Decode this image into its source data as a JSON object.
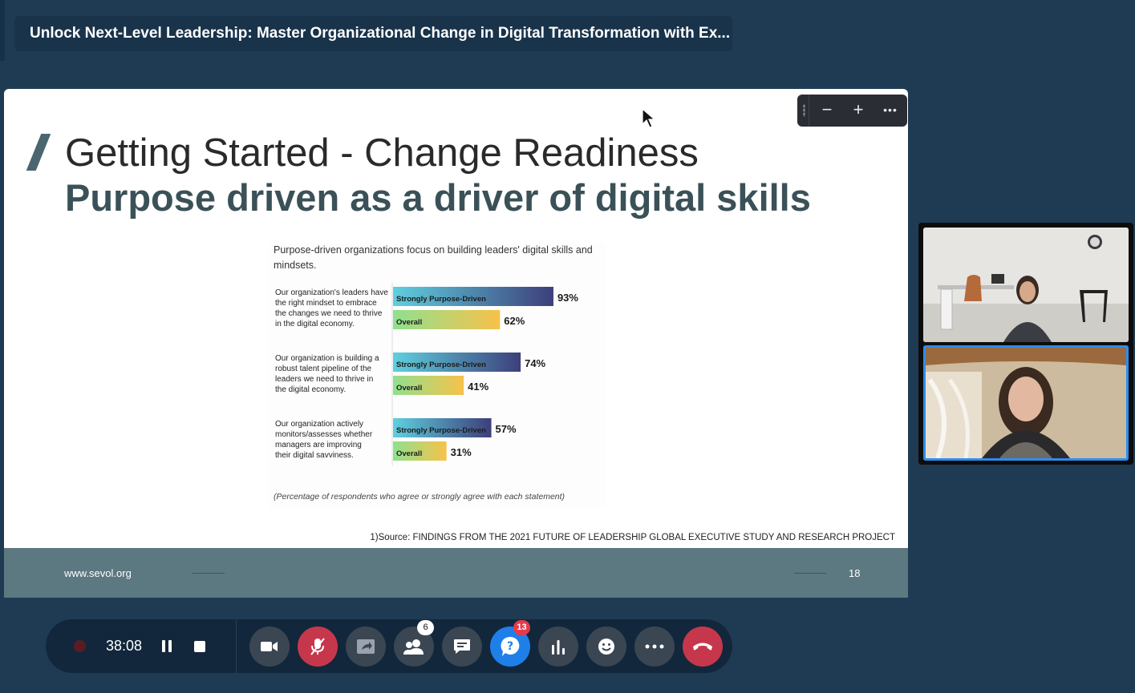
{
  "window": {
    "title": "Unlock Next-Level Leadership: Master Organizational Change in Digital Transformation with Ex..."
  },
  "slide": {
    "title": "Getting Started - Change Readiness",
    "subtitle": "Purpose driven as a driver of digital skills",
    "source": "1)Source: FINDINGS FROM THE 2021 FUTURE OF LEADERSHIP GLOBAL EXECUTIVE STUDY AND RESEARCH PROJECT",
    "footer_url": "www.sevol.org",
    "page_number": "18"
  },
  "chart_data": {
    "type": "bar",
    "title": "Purpose-driven organizations focus on building leaders' digital skills and mindsets.",
    "categories": [
      [
        "Our organization's leaders have",
        "the right mindset to embrace",
        "the changes we need to thrive",
        "in the digital economy."
      ],
      [
        "Our organization is building a",
        "robust talent pipeline of the",
        "leaders we need to thrive in",
        "the digital economy."
      ],
      [
        "Our organization actively",
        "monitors/assesses whether",
        "managers are improving",
        "their digital savviness."
      ]
    ],
    "series": [
      {
        "name": "Strongly Purpose-Driven",
        "values": [
          93,
          74,
          57
        ],
        "value_labels": [
          "93%",
          "74%",
          "57%"
        ]
      },
      {
        "name": "Overall",
        "values": [
          62,
          41,
          31
        ],
        "value_labels": [
          "62%",
          "41%",
          "31%"
        ]
      }
    ],
    "unit": "%",
    "xlim": [
      0,
      100
    ],
    "footnote": "(Percentage of respondents who agree or strongly agree with each statement)",
    "colors": {
      "strongly_start": "#5fd0df",
      "strongly_end": "#3d3f7a",
      "overall_start": "#8fe08f",
      "overall_end": "#f7c24a"
    }
  },
  "zoom_toolbar": {
    "zoom_out": "−",
    "zoom_in": "+",
    "more": "•••"
  },
  "controls": {
    "recording_time": "38:08",
    "participants_count": "6",
    "qa_count": "13"
  },
  "colors": {
    "background": "#1f3b53",
    "leave_button": "#c7374c",
    "mic_muted": "#c7374c",
    "qa_button": "#1f7fe8",
    "active_speaker_border": "#2d8cf0"
  }
}
